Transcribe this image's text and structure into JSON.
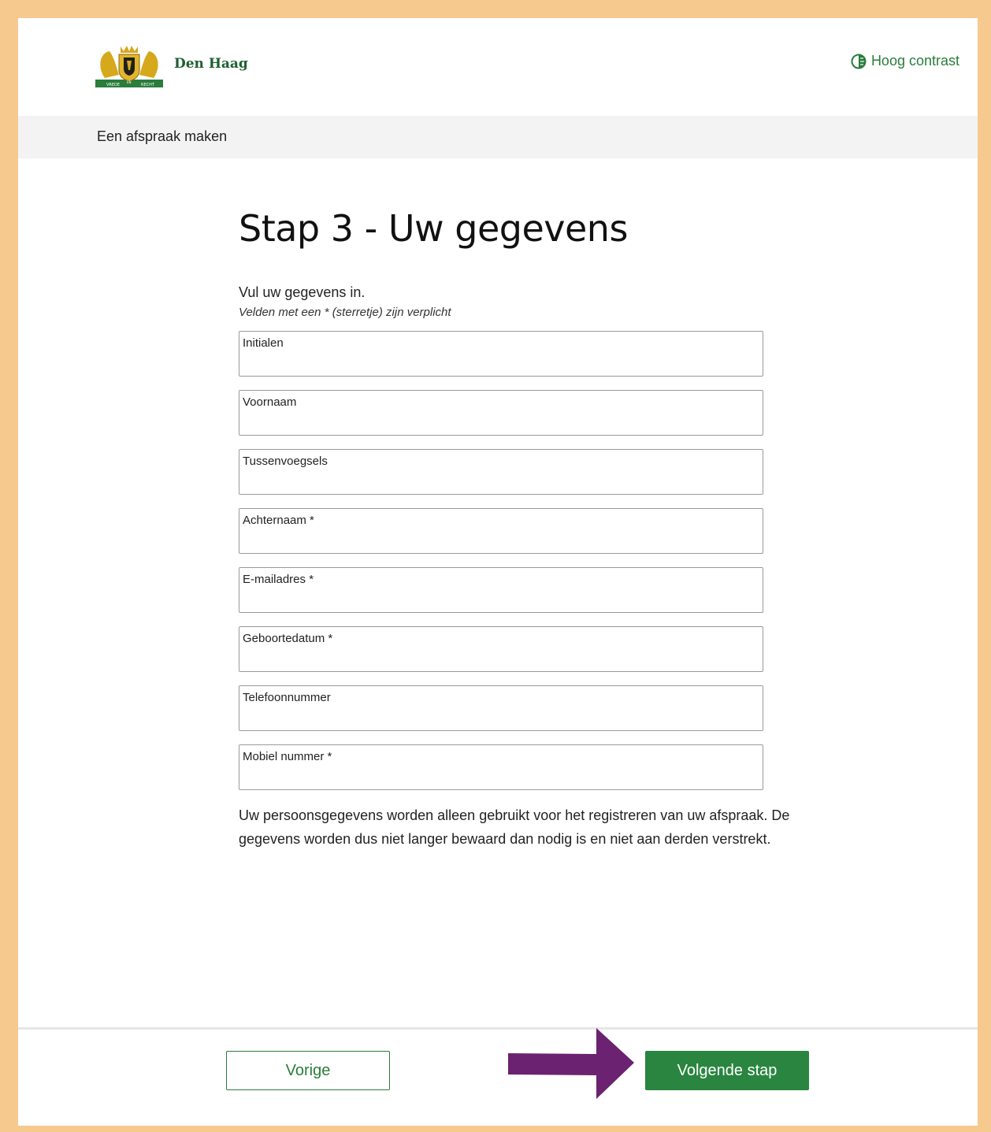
{
  "header": {
    "brand": "Den Haag",
    "contrast_label": "Hoog contrast",
    "logo_motto_left": "VREDE",
    "logo_motto_mid": "EN",
    "logo_motto_right": "RECHT"
  },
  "breadcrumb": {
    "label": "Een afspraak maken"
  },
  "main": {
    "title": "Stap 3 - Uw gegevens",
    "intro": "Vul uw gegevens in.",
    "required_note": "Velden met een * (sterretje) zijn verplicht",
    "fields": [
      {
        "label": "Initialen",
        "value": ""
      },
      {
        "label": "Voornaam",
        "value": ""
      },
      {
        "label": "Tussenvoegsels",
        "value": ""
      },
      {
        "label": "Achternaam *",
        "value": ""
      },
      {
        "label": "E-mailadres *",
        "value": ""
      },
      {
        "label": "Geboortedatum *",
        "value": ""
      },
      {
        "label": "Telefoonnummer",
        "value": ""
      },
      {
        "label": "Mobiel nummer *",
        "value": ""
      }
    ],
    "privacy": "Uw persoonsgegevens worden alleen gebruikt voor het registreren van uw afspraak. De gegevens worden dus niet langer bewaard dan nodig is en niet aan derden verstrekt."
  },
  "footer": {
    "prev_label": "Vorige",
    "next_label": "Volgende stap"
  },
  "colors": {
    "frame": "#f6c98f",
    "brand_green": "#2a8540",
    "arrow_purple": "#6b2270"
  }
}
